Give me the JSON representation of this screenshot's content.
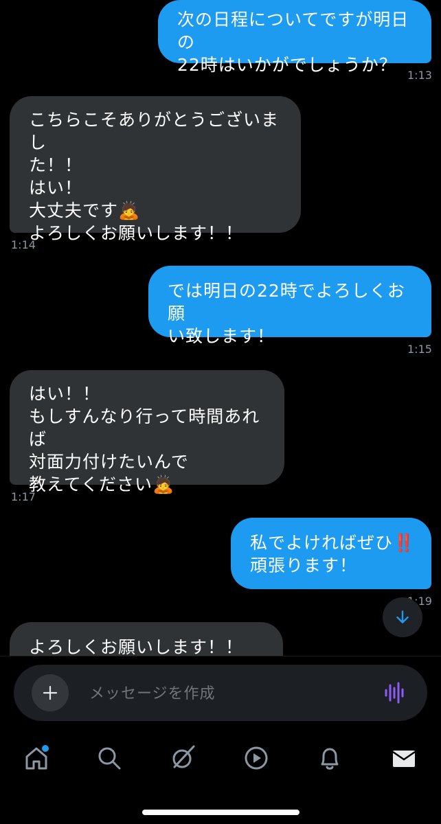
{
  "messages": [
    {
      "dir": "out",
      "text": "次の日程についてですが明日の\n22時はいかがでしょうか？",
      "time": "1:13"
    },
    {
      "dir": "in",
      "text": "こちらこそありがとうございまし\nた！！\nはい！\n大丈夫です🙇\nよろしくお願いします！！",
      "time": "1:14"
    },
    {
      "dir": "out",
      "text": "では明日の22時でよろしくお願\nい致します！",
      "time": "1:15"
    },
    {
      "dir": "in",
      "text": "はい！！\nもしすんなり行って時間あれば\n対面力付けたいんで\n教えてください🙇",
      "time": "1:17"
    },
    {
      "dir": "out",
      "text": "私でよければぜひ‼️\n頑張ります！",
      "time": "1:19"
    },
    {
      "dir": "in",
      "text": "よろしくお願いします！！"
    }
  ],
  "composer": {
    "placeholder": "メッセージを作成"
  },
  "tabs": [
    "home-icon",
    "search-icon",
    "grok-icon",
    "video-icon",
    "notifications-icon",
    "messages-icon"
  ],
  "colors": {
    "accent": "#1d9bf0",
    "incoming": "#2f3336",
    "voice": "#8b5cf6"
  }
}
